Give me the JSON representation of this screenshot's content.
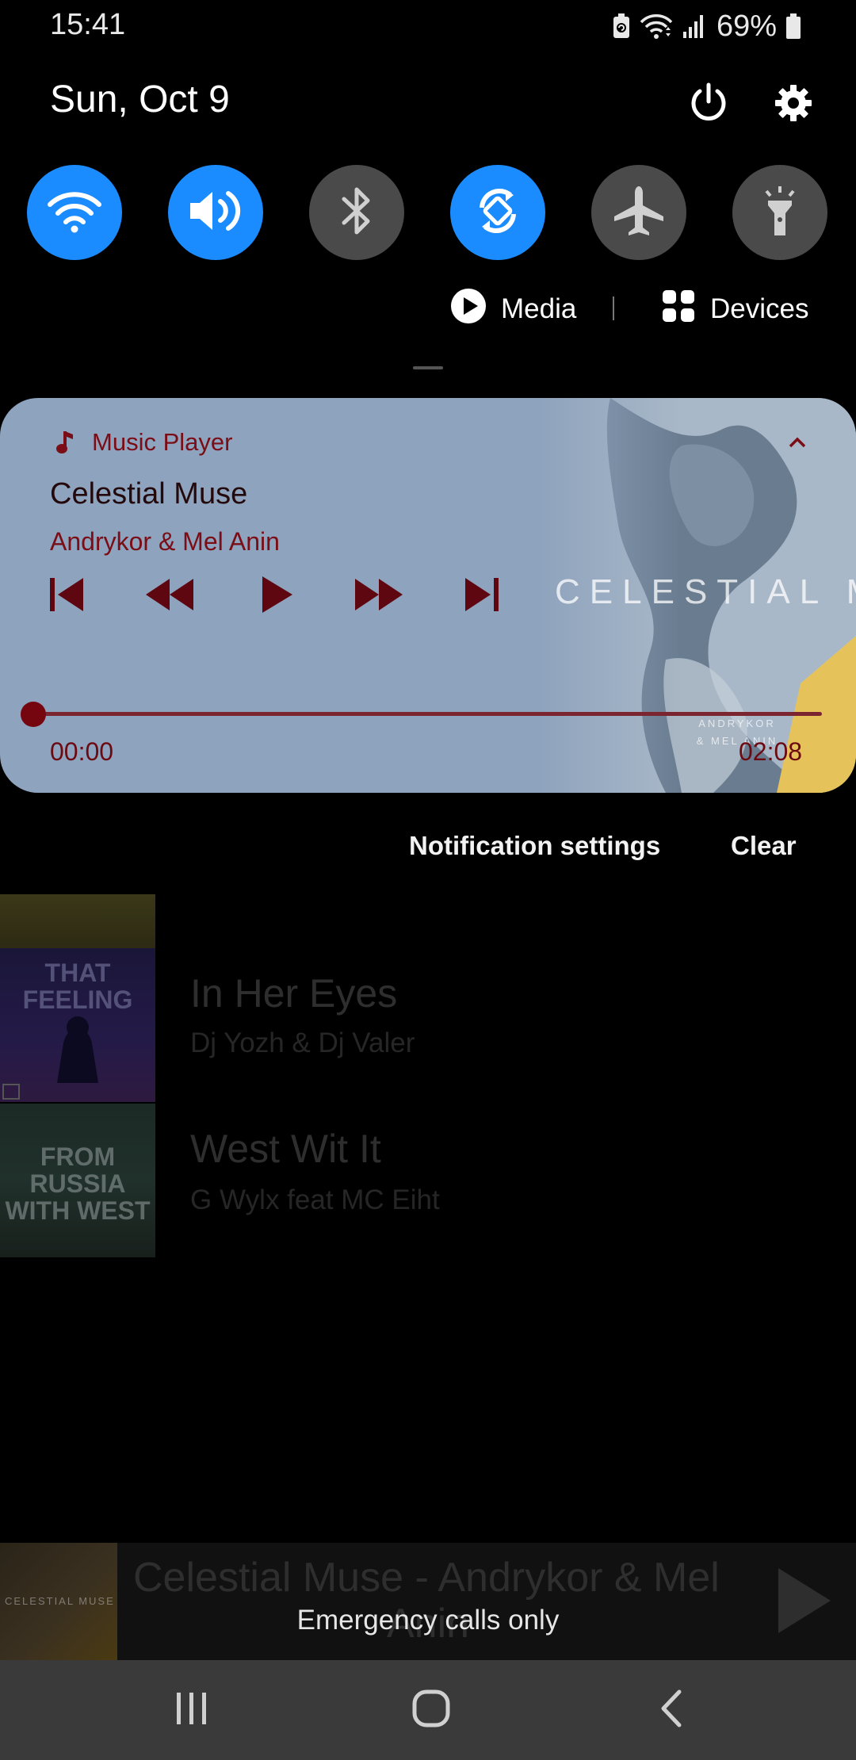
{
  "status_bar": {
    "time": "15:41",
    "battery_percent": "69%",
    "icons": [
      "battery-saver-icon",
      "wifi-data-icon",
      "signal-icon",
      "battery-icon"
    ]
  },
  "header": {
    "date": "Sun, Oct 9",
    "power_icon": "power-icon",
    "settings_icon": "gear-icon"
  },
  "quick_toggles": [
    {
      "name": "wifi",
      "state": "on"
    },
    {
      "name": "sound",
      "state": "on"
    },
    {
      "name": "bluetooth",
      "state": "off"
    },
    {
      "name": "auto-rotate",
      "state": "on"
    },
    {
      "name": "airplane-mode",
      "state": "off"
    },
    {
      "name": "flashlight",
      "state": "off"
    }
  ],
  "media_devices": {
    "media_label": "Media",
    "devices_label": "Devices"
  },
  "media_notification": {
    "app_name": "Music Player",
    "title": "Celestial Muse",
    "artist": "Andrykor & Mel Anin",
    "artwork_text": "CELESTIAL MU",
    "artwork_small_text": "ANDRYKOR & MEL ANIN",
    "position": "00:00",
    "duration": "02:08",
    "progress": 0,
    "controls": [
      "skip-previous-icon",
      "rewind-icon",
      "play-icon",
      "fast-forward-icon",
      "skip-next-icon"
    ]
  },
  "notification_actions": {
    "settings_label": "Notification settings",
    "clear_label": "Clear"
  },
  "background_list": [
    {
      "title": "In Her Eyes",
      "artist": "Dj Yozh & Dj Valer",
      "thumb_text": "THAT FEELING"
    },
    {
      "title": "West Wit It",
      "artist": "G Wylx feat MC Eiht",
      "thumb_text": "FROM RUSSIA WITH WEST"
    }
  ],
  "mini_player": {
    "title_line1": "Celestial Muse - Andrykor & Mel",
    "title_line2": "Anin",
    "art_text": "CELESTIAL MUSE"
  },
  "emergency_text": "Emergency calls only",
  "colors": {
    "toggle_on": "#1a8cff",
    "toggle_off": "#4a4a4a",
    "accent_dark_red": "#7a0d15"
  }
}
